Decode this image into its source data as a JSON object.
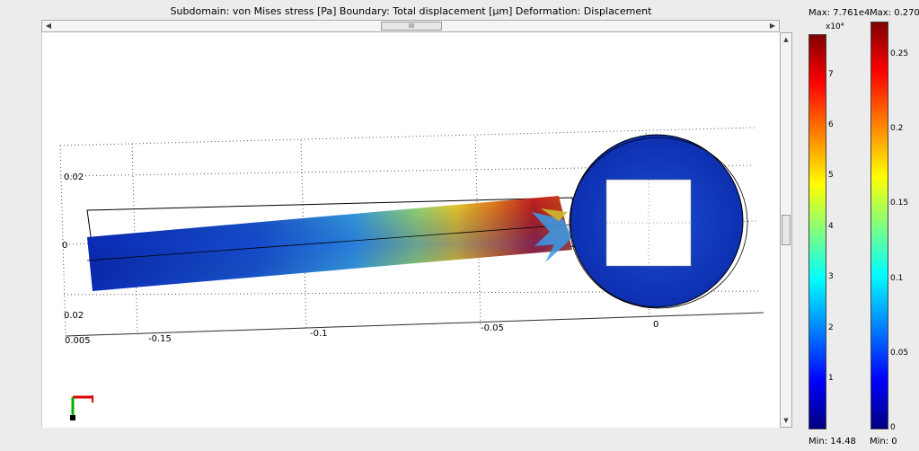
{
  "title": "Subdomain: von Mises stress [Pa]   Boundary: Total displacement [µm]   Deformation: Displacement",
  "scroll": {
    "left_arrow": "◀",
    "right_arrow": "▶",
    "thumb_grip": "III",
    "up_arrow": "▲",
    "down_arrow": "▼"
  },
  "axes": {
    "x_ticks": [
      "-0.15",
      "-0.1",
      "-0.05",
      "0"
    ],
    "y_ticks": [
      "0.02",
      "0",
      "0.02"
    ],
    "corner_label": "0.005"
  },
  "colorbar_stress": {
    "max_label": "Max: 7.761e4",
    "min_label": "Min: 14.48",
    "exponent": "x10⁴",
    "ticks": [
      "7",
      "6",
      "5",
      "4",
      "3",
      "2",
      "1"
    ]
  },
  "colorbar_disp": {
    "max_label": "Max: 0.270",
    "min_label": "Min: 0",
    "ticks": [
      "0.25",
      "0.2",
      "0.15",
      "0.1",
      "0.05",
      "0"
    ]
  },
  "colors": {
    "jet_top": "#800000",
    "jet_bottom": "#00007f",
    "axis_x": "#e00000",
    "axis_y": "#00b000"
  }
}
